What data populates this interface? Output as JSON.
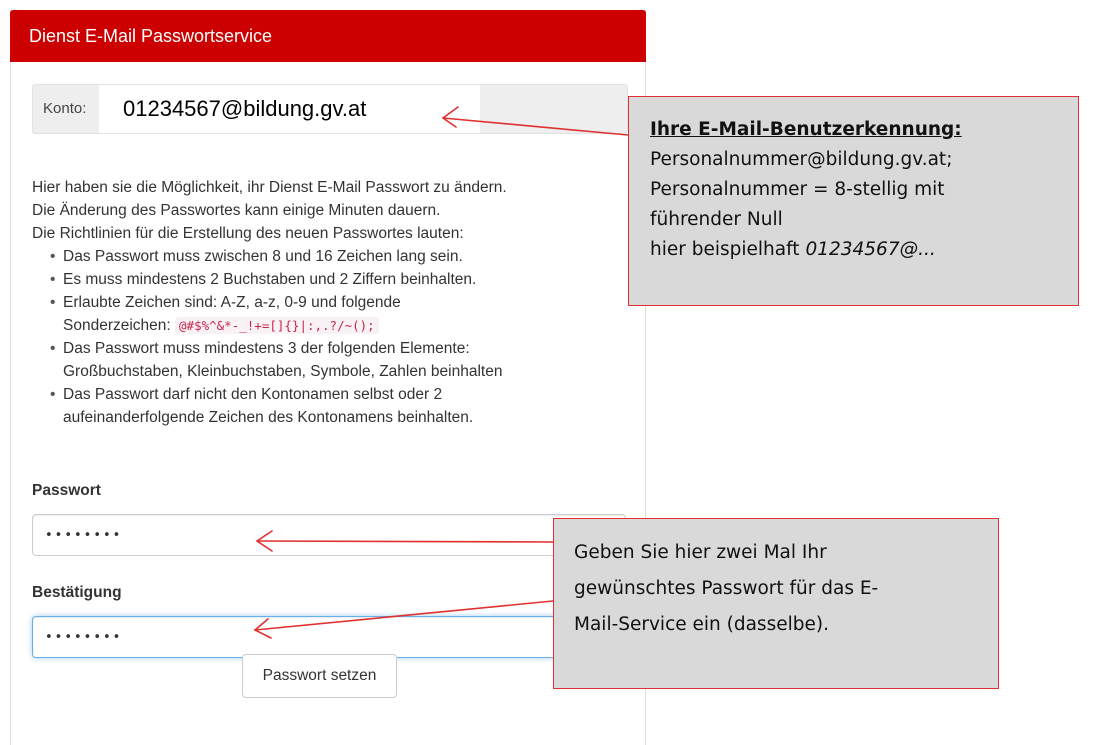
{
  "panel": {
    "title": "Dienst E-Mail Passwortservice"
  },
  "account": {
    "label": "Konto:",
    "value": "01234567@bildung.gv.at"
  },
  "intro": {
    "lines": [
      "Hier haben sie die Möglichkeit, ihr Dienst E-Mail Passwort zu ändern.",
      "Die Änderung des Passwortes kann einige Minuten dauern.",
      "Die Richtlinien für die Erstellung des neuen Passwortes lauten:"
    ],
    "rules": [
      [
        "Das Passwort muss zwischen 8 und 16 Zeichen lang sein."
      ],
      [
        "Es muss mindestens 2 Buchstaben und 2 Ziffern beinhalten."
      ],
      [
        "Erlaubte Zeichen sind: A-Z, a-z, 0-9 und folgende",
        "Sonderzeichen:"
      ],
      [
        "Das Passwort muss mindestens 3 der folgenden Elemente:",
        "Großbuchstaben, Kleinbuchstaben, Symbole, Zahlen beinhalten"
      ],
      [
        "Das Passwort darf nicht den Kontonamen selbst oder 2",
        "aufeinanderfolgende Zeichen des Kontonamens beinhalten."
      ]
    ],
    "special_chars": "@#$%^&*-_!+=[]{}|:,.?/~();"
  },
  "form": {
    "password_label": "Passwort",
    "password_value": "••••••••",
    "confirm_label": "Bestätigung",
    "confirm_value": "••••••••",
    "submit_label": "Passwort setzen"
  },
  "callouts": {
    "account_info": {
      "heading": "Ihre E-Mail-Benutzerkennung:",
      "lines": [
        "Personalnummer@bildung.gv.at;",
        "Personalnummer =  8-stellig mit",
        "führender Null"
      ],
      "example_prefix": "hier beispielhaft ",
      "example_value": "01234567@..."
    },
    "password_info": {
      "lines": [
        "Geben Sie hier zwei Mal Ihr",
        "gewünschtes Passwort für das E-",
        "Mail-Service ein (dasselbe)."
      ]
    }
  },
  "colors": {
    "header_red": "#cc0000",
    "callout_border": "#e03030",
    "callout_fill": "#d9d9d9",
    "focus_blue": "#66afe9"
  }
}
